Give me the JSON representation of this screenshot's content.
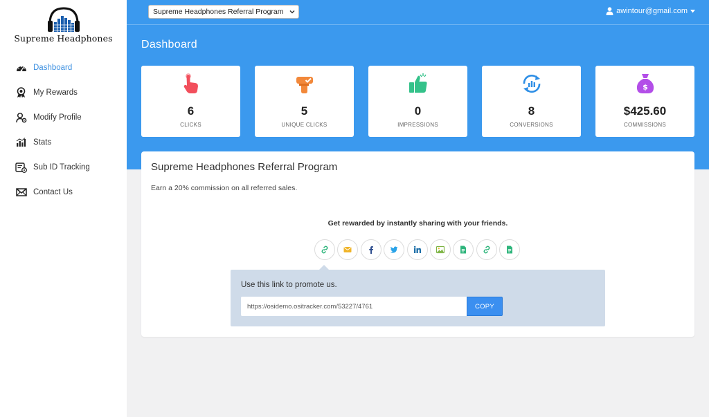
{
  "brand": {
    "name": "Supreme Headphones"
  },
  "sidebar": {
    "items": [
      {
        "label": "Dashboard",
        "icon": "dashboard-icon",
        "active": true
      },
      {
        "label": "My Rewards",
        "icon": "award-icon"
      },
      {
        "label": "Modify Profile",
        "icon": "user-gear-icon"
      },
      {
        "label": "Stats",
        "icon": "bar-chart-icon"
      },
      {
        "label": "Sub ID Tracking",
        "icon": "tracking-icon"
      },
      {
        "label": "Contact Us",
        "icon": "envelope-icon"
      }
    ]
  },
  "header": {
    "program_select": "Supreme Headphones Referral Program",
    "user_email": "awintour@gmail.com",
    "page_title": "Dashboard"
  },
  "stats": [
    {
      "value": "6",
      "label": "CLICKS",
      "icon": "hand-pointer-icon",
      "color": "#f24f5c"
    },
    {
      "value": "5",
      "label": "UNIQUE CLICKS",
      "icon": "hand-check-icon",
      "color": "#f2883a"
    },
    {
      "value": "0",
      "label": "IMPRESSIONS",
      "icon": "thumbs-up-icon",
      "color": "#34c28a"
    },
    {
      "value": "8",
      "label": "CONVERSIONS",
      "icon": "refresh-chart-icon",
      "color": "#2f8fe6"
    },
    {
      "value": "$425.60",
      "label": "COMMISSIONS",
      "icon": "money-bag-icon",
      "color": "#b34ee8"
    }
  ],
  "program": {
    "title": "Supreme Headphones Referral Program",
    "description": "Earn a 20% commission on all referred sales.",
    "share_heading": "Get rewarded by instantly sharing with your friends.",
    "share_buttons": [
      {
        "icon": "link-icon",
        "color": "#2fb57c"
      },
      {
        "icon": "email-icon",
        "color": "#f0b429"
      },
      {
        "icon": "facebook-icon",
        "color": "#2f4f8f"
      },
      {
        "icon": "twitter-icon",
        "color": "#2aa3e8"
      },
      {
        "icon": "linkedin-icon",
        "color": "#1d6fa8"
      },
      {
        "icon": "image-icon",
        "color": "#7cb342"
      },
      {
        "icon": "document-icon",
        "color": "#2fb57c"
      },
      {
        "icon": "link-icon",
        "color": "#2fb57c"
      },
      {
        "icon": "document-icon",
        "color": "#2fb57c"
      }
    ],
    "promo_label": "Use this link to promote us.",
    "promo_link": "https://osidemo.ositracker.com/53227/4761",
    "copy_label": "COPY"
  },
  "colors": {
    "header_blue": "#3b99ee",
    "active_nav": "#3b8fe0",
    "copy_button": "#3b8ff0"
  }
}
